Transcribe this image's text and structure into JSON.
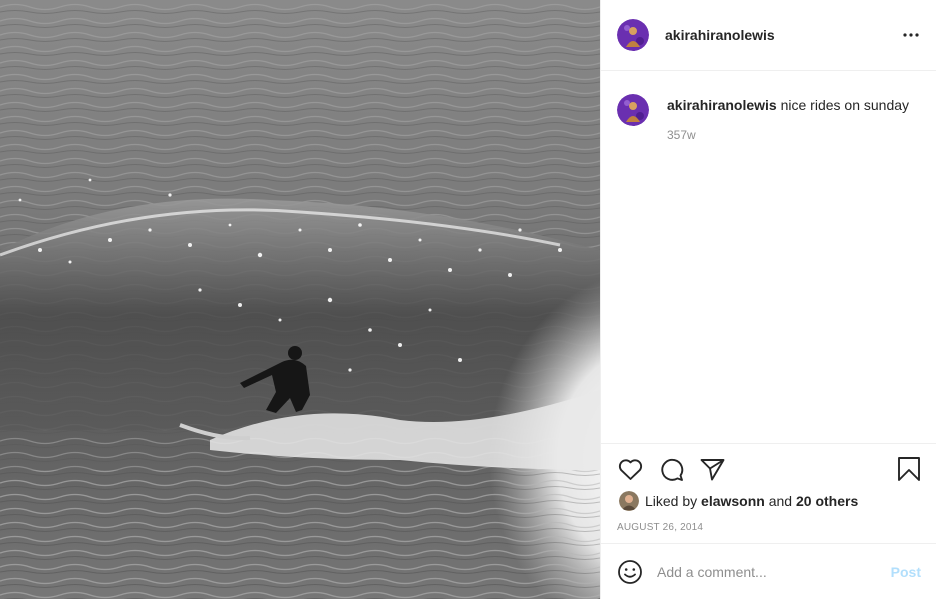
{
  "post": {
    "photo_alt": "",
    "author": {
      "username": "akirahiranolewis"
    },
    "caption": {
      "username": "akirahiranolewis",
      "text": "nice rides on sunday",
      "age": "357w"
    },
    "likes": {
      "prefix": "Liked by ",
      "user": "elawsonn",
      "middle": " and ",
      "others": "20 others"
    },
    "date": "AUGUST 26, 2014",
    "comment": {
      "placeholder": "Add a comment...",
      "post_label": "Post"
    },
    "icons": {
      "more": "more-options-icon",
      "like": "heart-icon",
      "comment": "comment-bubble-icon",
      "share": "paper-plane-icon",
      "save": "bookmark-icon",
      "emoji": "smiley-icon"
    },
    "colors": {
      "text": "#262626",
      "secondary": "#8e8e8e",
      "border": "#efefef",
      "post_disabled": "#b2dffc",
      "avatar_purple": "#6a2fb0"
    }
  }
}
